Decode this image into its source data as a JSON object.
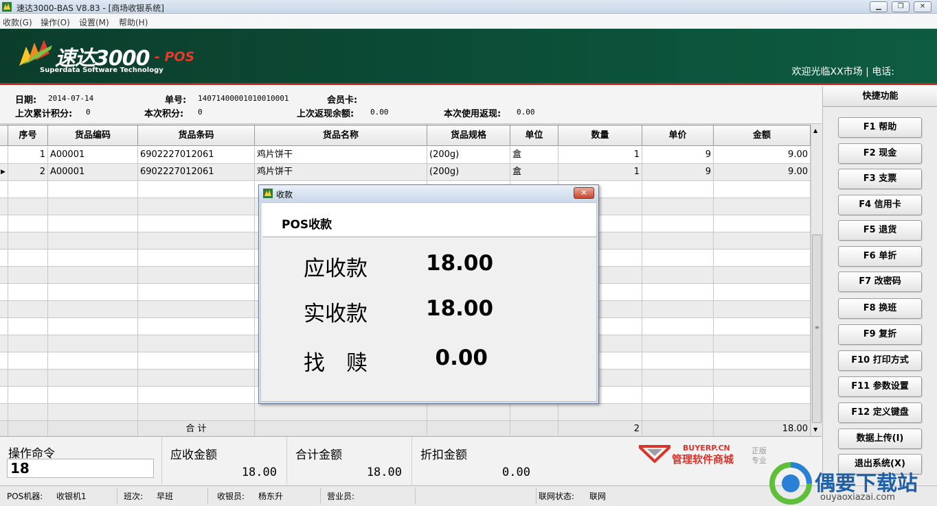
{
  "window": {
    "title": "速达3000-BAS V8.83 - [商场收银系统]"
  },
  "menu": [
    "收款(G)",
    "操作(O)",
    "设置(M)",
    "帮助(H)"
  ],
  "banner": {
    "brand": "速达3000",
    "brand_suffix": "- POS",
    "subtitle": "Superdata Software Technology",
    "welcome": "欢迎光临XX市场 | 电话:"
  },
  "info": {
    "date_label": "日期:",
    "date_value": "2014-07-14",
    "order_label": "单号:",
    "order_value": "14071400001010010001",
    "member_label": "会员卡:",
    "member_value": "",
    "prev_points_label": "上次累计积分:",
    "prev_points_value": "0",
    "cur_points_label": "本次积分:",
    "cur_points_value": "0",
    "prev_cashback_label": "上次返现余额:",
    "prev_cashback_value": "0.00",
    "cur_cashback_label": "本次使用返现:",
    "cur_cashback_value": "0.00"
  },
  "table": {
    "columns": [
      "序号",
      "货品编码",
      "货品条码",
      "货品名称",
      "货品规格",
      "单位",
      "数量",
      "单价",
      "金额"
    ],
    "rows": [
      [
        "1",
        "A00001",
        "6902227012061",
        "鸡片饼干",
        "(200g)",
        "盒",
        "1",
        "9",
        "9.00"
      ],
      [
        "2",
        "A00001",
        "6902227012061",
        "鸡片饼干",
        "(200g)",
        "盒",
        "1",
        "9",
        "9.00"
      ]
    ],
    "total_label": "合 计",
    "total_qty": "2",
    "total_amount": "18.00"
  },
  "shortcut": {
    "title": "快捷功能",
    "keys": [
      "F1 帮助",
      "F2 现金",
      "F3 支票",
      "F4 信用卡",
      "F5 退货",
      "F6 单折",
      "F7 改密码",
      "F8 换班",
      "F9 复折",
      "F10 打印方式",
      "F11 参数设置",
      "F12 定义键盘",
      "数据上传(I)",
      "退出系统(X)"
    ]
  },
  "bottom": {
    "command_label": "操作命令",
    "command_value": "18",
    "receivable_label": "应收金额",
    "receivable_value": "18.00",
    "total_label": "合计金额",
    "total_value": "18.00",
    "discount_label": "折扣金额",
    "discount_value": "0.00",
    "ad_brand": "BUYERP.CN",
    "ad_name": "管理软件商城",
    "ad_tag1": "正版",
    "ad_tag2": "专业"
  },
  "status": {
    "pos_label": "POS机器:",
    "pos_value": "收银机1",
    "shift_label": "班次:",
    "shift_value": "早班",
    "cashier_label": "收银员:",
    "cashier_value": "杨东升",
    "clerk_label": "营业员:",
    "clerk_value": "",
    "net_label": "联网状态:",
    "net_value": "联网"
  },
  "dialog": {
    "title": "收款",
    "heading": "POS收款",
    "receivable_label": "应收款",
    "receivable_value": "18.00",
    "paid_label": "实收款",
    "paid_value": "18.00",
    "change_label": "找　赎",
    "change_value": "0.00"
  },
  "watermark": {
    "name": "偶要下载站",
    "url": "ouyaoxiazai.com"
  },
  "colors": {
    "banner_green": "#0b4b35",
    "banner_red_line": "#c4281c",
    "brand_pos_red": "#e83a2a"
  }
}
